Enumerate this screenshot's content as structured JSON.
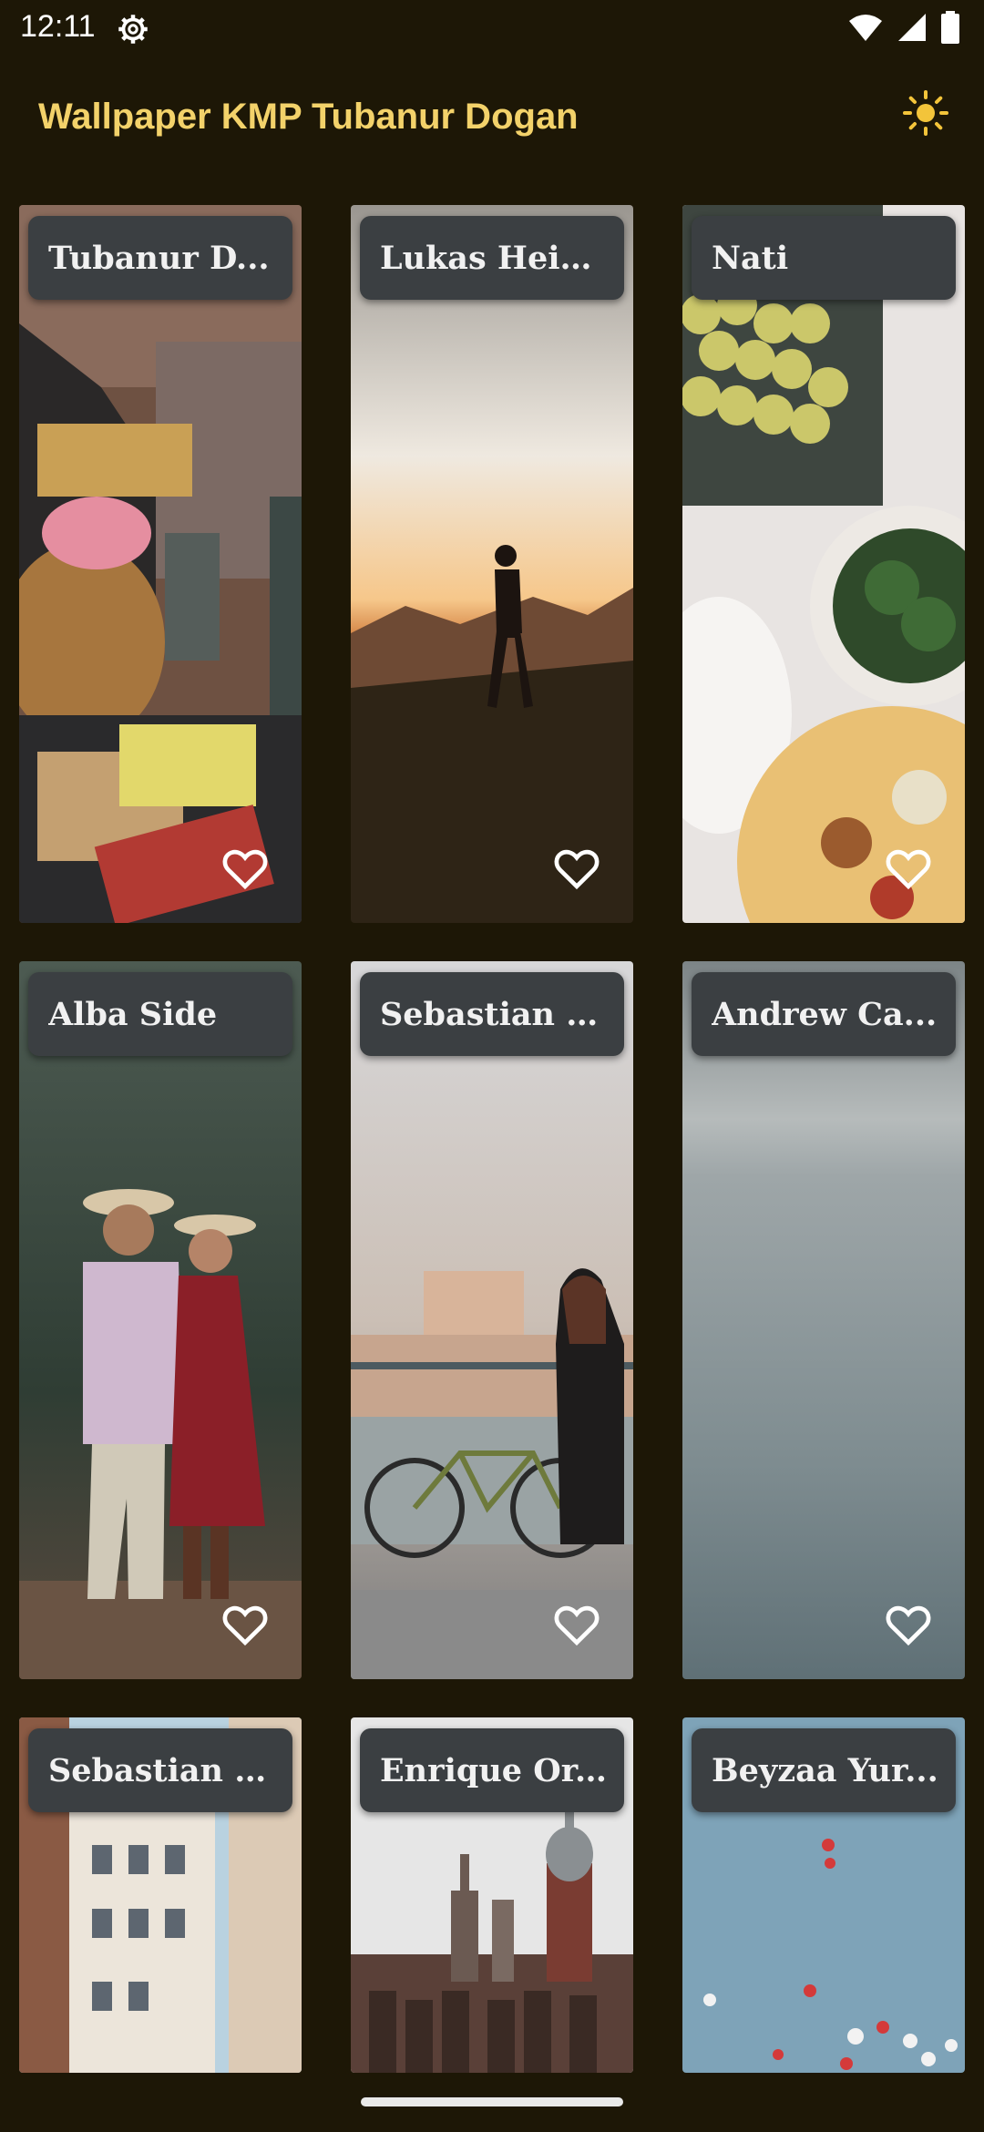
{
  "status_bar": {
    "time": "12:11"
  },
  "app_bar": {
    "title": "Wallpaper KMP Tubanur Dogan"
  },
  "wallpapers": [
    {
      "author": "Tubanur D..."
    },
    {
      "author": "Lukas Hein..."
    },
    {
      "author": "Nati"
    },
    {
      "author": "Alba  Side"
    },
    {
      "author": "Sebastian L..."
    },
    {
      "author": "Andrew Ca..."
    },
    {
      "author": "Sebastian L..."
    },
    {
      "author": "Enrique Or..."
    },
    {
      "author": "Beyzaa Yur..."
    }
  ],
  "colors": {
    "background": "#1d1706",
    "title": "#f3d26a",
    "chip": "#3b3f42"
  },
  "icons": {
    "settings": "gear-icon",
    "wifi": "wifi-icon",
    "signal": "signal-icon",
    "battery": "battery-icon",
    "theme": "sun-icon",
    "favorite": "heart-outline-icon"
  }
}
